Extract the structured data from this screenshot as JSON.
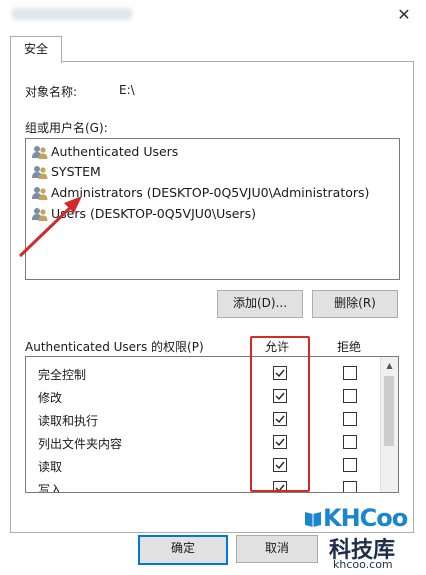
{
  "window": {
    "close_glyph": "✕"
  },
  "tabs": [
    {
      "label": "安全"
    }
  ],
  "object": {
    "label": "对象名称:",
    "value": "E:\\"
  },
  "groups": {
    "label": "组或用户名(G):",
    "items": [
      {
        "name": "Authenticated Users",
        "icon": "users-icon"
      },
      {
        "name": "SYSTEM",
        "icon": "users-icon"
      },
      {
        "name": "Administrators (DESKTOP-0Q5VJU0\\Administrators)",
        "icon": "users-icon"
      },
      {
        "name": "Users (DESKTOP-0Q5VJU0\\Users)",
        "icon": "users-icon"
      }
    ]
  },
  "buttons": {
    "add": "添加(D)...",
    "remove": "删除(R)"
  },
  "permissions": {
    "label": "Authenticated Users 的权限(P)",
    "allow_header": "允许",
    "deny_header": "拒绝",
    "rows": [
      {
        "name": "完全控制",
        "allow": true,
        "deny": false
      },
      {
        "name": "修改",
        "allow": true,
        "deny": false
      },
      {
        "name": "读取和执行",
        "allow": true,
        "deny": false
      },
      {
        "name": "列出文件夹内容",
        "allow": true,
        "deny": false
      },
      {
        "name": "读取",
        "allow": true,
        "deny": false
      },
      {
        "name": "写入",
        "allow": true,
        "deny": false
      }
    ]
  },
  "footer": {
    "ok": "确定",
    "cancel": "取消"
  },
  "watermark": {
    "brand": "KHCoo",
    "cn": "科技库",
    "url": "khcoo.com"
  },
  "colors": {
    "highlight": "#d22a2a",
    "accent": "#0078d7",
    "watermark_blue": "#1a86d0"
  }
}
